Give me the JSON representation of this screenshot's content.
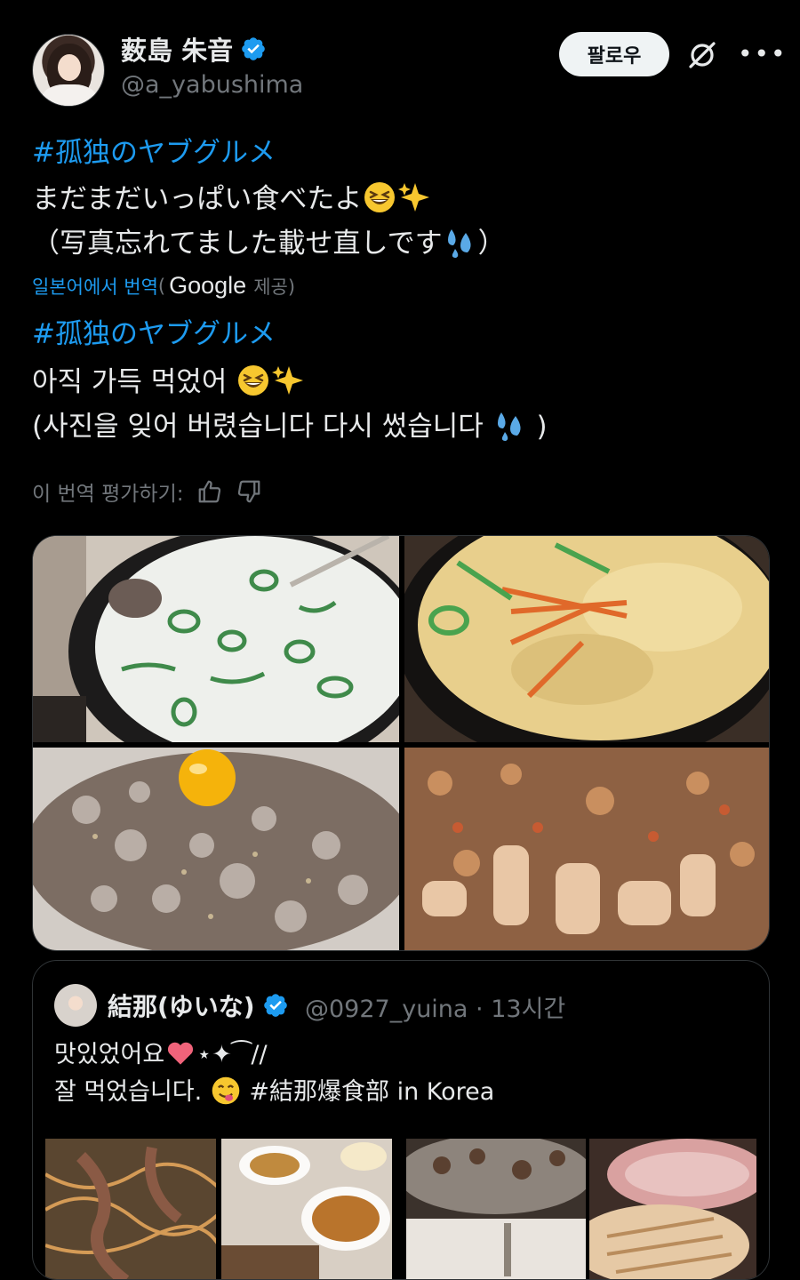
{
  "author": {
    "display_name": "薮島 朱音",
    "handle": "@a_yabushima",
    "follow_label": "팔로우"
  },
  "tweet": {
    "original_hashtag": "#孤独のヤブグルメ",
    "original_line1": "まだまだいっぱい食べたよ",
    "original_line2": "（写真忘れてました載せ直しです",
    "original_line2_end": "）",
    "translated_from": "일본어에서 번역",
    "translated_by_prefix": "(",
    "translated_by_brand": "Google",
    "translated_by_suffix": "제공)",
    "translated_hashtag": "#孤独のヤブグルメ",
    "translated_line1": "아직 가득 먹었어 ",
    "translated_line2": "(사진을 잊어 버렸습니다 다시 썼습니다 ",
    "translated_line2_end": " )",
    "rate_label": "이 번역 평가하기:"
  },
  "photos": [
    "seolleongtang-soup",
    "gyeran-jjim-steamed-egg",
    "raw-octopus-with-egg-yolk",
    "octopus-fried-rice"
  ],
  "quote": {
    "display_name": "結那(ゆいな)",
    "handle_time": "@0927_yuina · 13시간",
    "line1": "맛있었어요",
    "line1_tail": "⋆✦⁀//",
    "line2": "잘 먹었습니다. ",
    "line2_tail": " #結那爆食部 in Korea"
  },
  "colors": {
    "background": "#000000",
    "text": "#e7e9ea",
    "secondary": "#71767b",
    "accent": "#1d9bf0",
    "border": "#2f3336"
  },
  "icons": [
    "verified-badge-icon",
    "grok-icon",
    "more-icon",
    "thumbs-up-icon",
    "thumbs-down-icon",
    "grinning-squint-emoji",
    "sparkles-emoji",
    "sweat-droplets-emoji",
    "heart-emoji",
    "yum-emoji"
  ]
}
